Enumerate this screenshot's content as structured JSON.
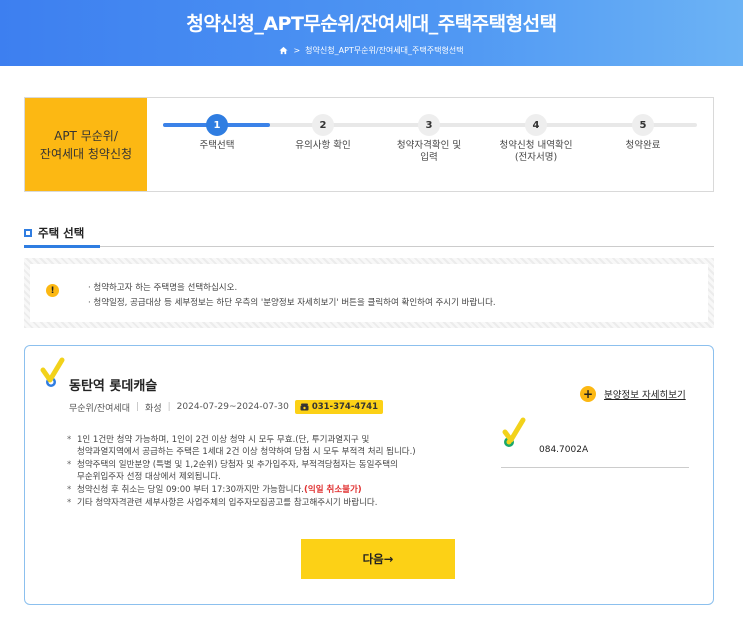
{
  "header": {
    "title": "청약신청_APT무순위/잔여세대_주택주택형선택",
    "breadcrumb": "청약신청_APT무순위/잔여세대_주택주택형선택"
  },
  "steps": {
    "label_line1": "APT 무순위/",
    "label_line2": "잔여세대 청약신청",
    "items": [
      {
        "num": "1",
        "label": "주택선택",
        "label2": ""
      },
      {
        "num": "2",
        "label": "유의사항 확인",
        "label2": ""
      },
      {
        "num": "3",
        "label": "청약자격확인 및",
        "label2": "입력"
      },
      {
        "num": "4",
        "label": "청약신청 내역확인",
        "label2": "(전자서명)"
      },
      {
        "num": "5",
        "label": "청약완료",
        "label2": ""
      }
    ],
    "current_step": 1
  },
  "section": {
    "title": "주택 선택"
  },
  "notice": {
    "line1": "· 청약하고자 하는 주택명을 선택하십시오.",
    "line2": "· 청약일정, 공급대상 등 세부정보는 하단 우측의 '분양정보 자세히보기' 버튼을 클릭하여 확인하여 주시기 바랍니다."
  },
  "card": {
    "apt_name": "동탄역 롯데캐슬",
    "type": "무순위/잔여세대",
    "region": "화성",
    "period": "2024-07-29~2024-07-30",
    "phone": "031-374-4741",
    "detail_link": "분양정보 자세히보기",
    "rules": {
      "r1a": "1인 1건만 청약 가능하며, 1인이 2건 이상 청약 시 모두 무효.(단, 투기과열지구 및",
      "r1b": "청약과열지역에서 공급하는 주택은 1세대 2건 이상 청약하여 당첨 시 모두 부적격 처리 됩니다.)",
      "r2a": "청약주택의 일반분양 (특별 및 1,2순위) 당첨자 및 추가입주자, 부적격당첨자는 동일주택의",
      "r2b": "무순위입주자 선정 대상에서 제외됩니다.",
      "r3": "청약신청 후 취소는 당일 09:00 부터 17:30까지만 가능합니다.",
      "r3_red": "(익일 취소불가)",
      "r4": "기타 청약자격관련 세부사항은 사업주체의 입주자모집공고를 참고해주시기 바랍니다."
    },
    "housing_code": "084.7002A",
    "next_button": "다음→"
  },
  "colors": {
    "header_blue": "#3d7ff0",
    "accent_yellow": "#fcb813",
    "button_yellow": "#fcd116",
    "active_step": "#2f7de1",
    "warning_red": "#e03030"
  },
  "icons": [
    "home-icon",
    "warning-icon",
    "check-icon",
    "plus-icon",
    "phone-icon"
  ]
}
